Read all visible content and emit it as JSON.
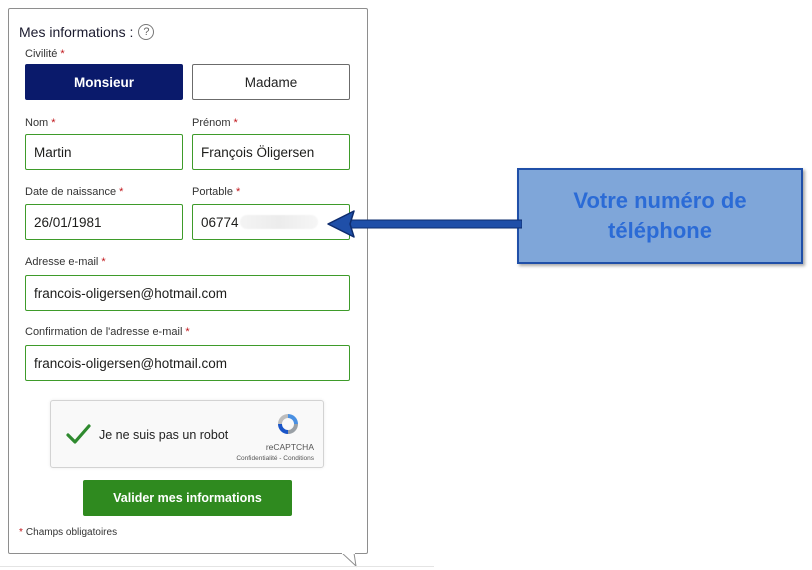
{
  "form": {
    "title": "Mes informations :",
    "help_icon": "?",
    "civility": {
      "label": "Civilité",
      "options": [
        "Monsieur",
        "Madame"
      ],
      "selected": "Monsieur"
    },
    "nom": {
      "label": "Nom",
      "value": "Martin"
    },
    "prenom": {
      "label": "Prénom",
      "value": "François Öligersen"
    },
    "birthdate": {
      "label": "Date de naissance",
      "value": "26/01/1981"
    },
    "portable": {
      "label": "Portable",
      "value_visible": "06774"
    },
    "email": {
      "label": "Adresse e-mail",
      "value": "francois-oligersen@hotmail.com"
    },
    "email_confirm": {
      "label": "Confirmation de l'adresse e-mail",
      "value": "francois-oligersen@hotmail.com"
    },
    "required_star": "*",
    "recaptcha": {
      "text": "Je ne suis pas un robot",
      "brand": "reCAPTCHA",
      "links": "Confidentialité - Conditions"
    },
    "submit_label": "Valider mes informations",
    "required_note": "Champs obligatoires"
  },
  "callout": {
    "text": "Votre numéro de téléphone"
  },
  "colors": {
    "navy": "#0a1a6b",
    "green_border": "#3e9b2a",
    "submit_green": "#2f8a1f",
    "required_red": "#c0161b",
    "callout_fill": "#7fa6d9",
    "callout_text": "#2b6bd6",
    "arrow": "#1f4fa8"
  },
  "icons": [
    "help-icon",
    "checkmark-icon",
    "recaptcha-logo-icon",
    "arrow-left-icon"
  ]
}
